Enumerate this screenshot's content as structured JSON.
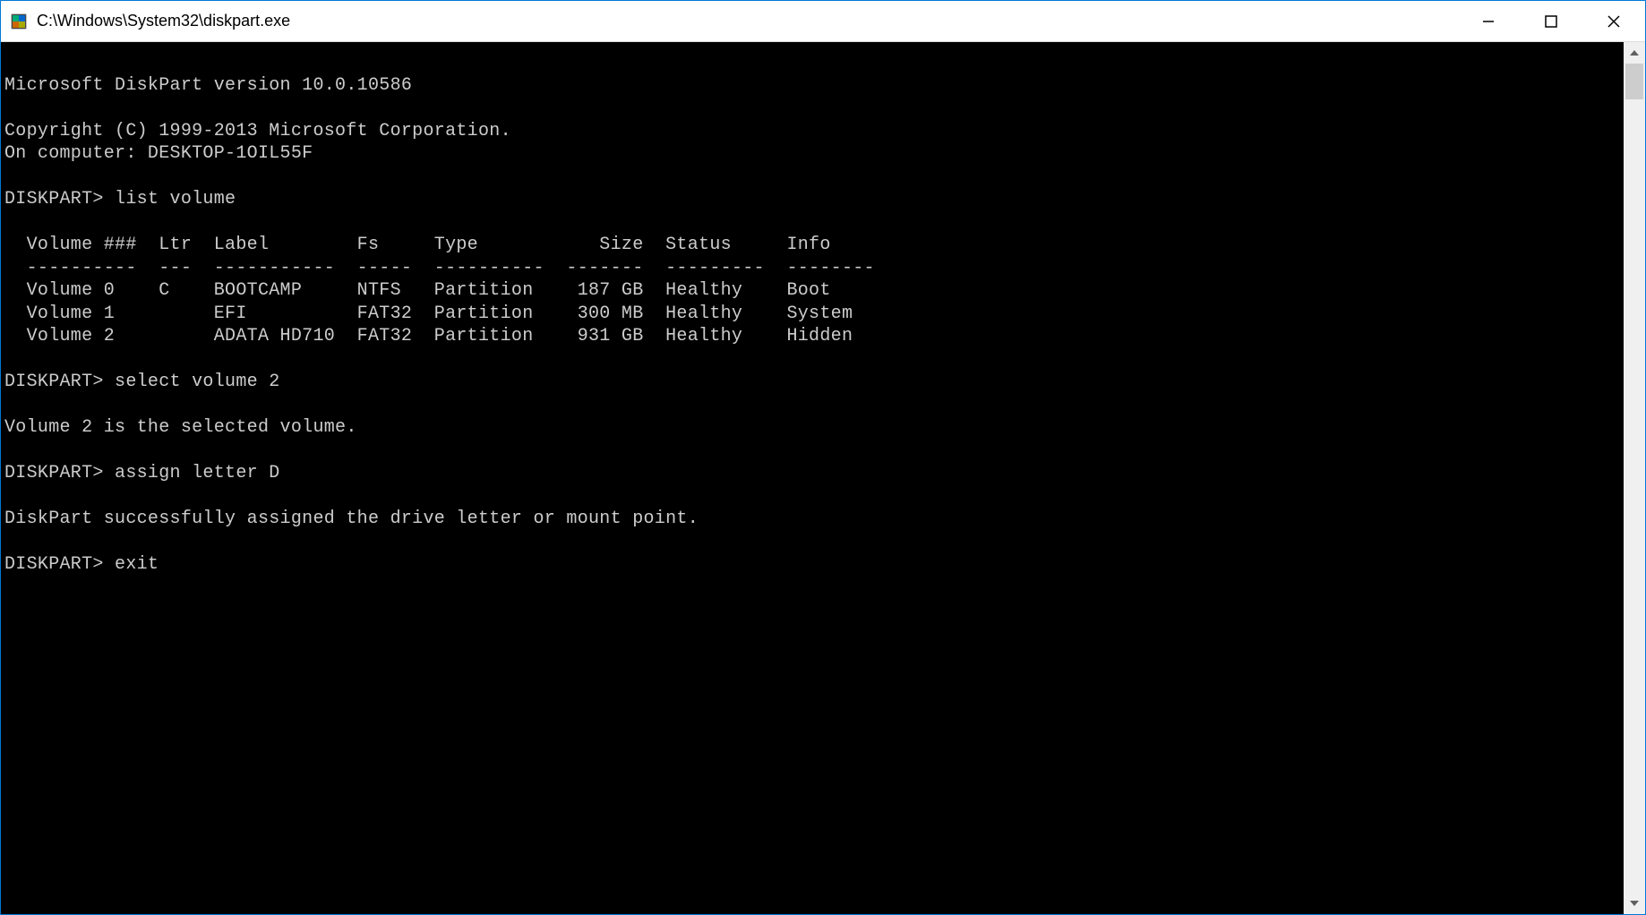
{
  "window": {
    "title": "C:\\Windows\\System32\\diskpart.exe"
  },
  "terminal": {
    "version_line": "Microsoft DiskPart version 10.0.10586",
    "copyright": "Copyright (C) 1999-2013 Microsoft Corporation.",
    "computer": "On computer: DESKTOP-1OIL55F",
    "prompt": "DISKPART>",
    "commands": {
      "list_volume": "list volume",
      "select_volume": "select volume 2",
      "assign_letter": "assign letter D",
      "exit": "exit"
    },
    "table": {
      "header": {
        "volume": "Volume ###",
        "ltr": "Ltr",
        "label": "Label",
        "fs": "Fs",
        "type": "Type",
        "size": "Size",
        "status": "Status",
        "info": "Info"
      },
      "separator": {
        "volume": "----------",
        "ltr": "---",
        "label": "-----------",
        "fs": "-----",
        "type": "----------",
        "size": "-------",
        "status": "---------",
        "info": "--------"
      },
      "rows": [
        {
          "volume": "Volume 0",
          "ltr": "C",
          "label": "BOOTCAMP",
          "fs": "NTFS",
          "type": "Partition",
          "size": "187 GB",
          "status": "Healthy",
          "info": "Boot"
        },
        {
          "volume": "Volume 1",
          "ltr": "",
          "label": "EFI",
          "fs": "FAT32",
          "type": "Partition",
          "size": "300 MB",
          "status": "Healthy",
          "info": "System"
        },
        {
          "volume": "Volume 2",
          "ltr": "",
          "label": "ADATA HD710",
          "fs": "FAT32",
          "type": "Partition",
          "size": "931 GB",
          "status": "Healthy",
          "info": "Hidden"
        }
      ]
    },
    "responses": {
      "volume_selected": "Volume 2 is the selected volume.",
      "letter_assigned": "DiskPart successfully assigned the drive letter or mount point."
    }
  }
}
